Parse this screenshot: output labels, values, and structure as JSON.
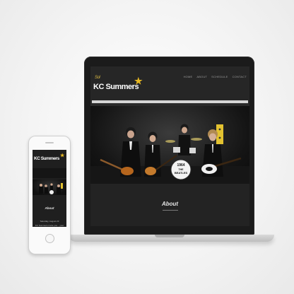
{
  "site": {
    "logo_main": "KC Summers",
    "logo_sub": "Sol",
    "nav": [
      "HOME",
      "ABOUT",
      "SCHEDULE",
      "CONTACT"
    ],
    "about_heading": "About",
    "drum_text": [
      "1964",
      "THE",
      "BEATLES"
    ]
  },
  "phone": {
    "logo_main": "KC Summers",
    "about_heading": "About",
    "date": "Saturday, August 23",
    "excerpt": "KC Summers invite you... your"
  },
  "colors": {
    "accent_gold": "#e8b923",
    "page_bg": "#2a2a2a",
    "header_bg": "#262626"
  }
}
